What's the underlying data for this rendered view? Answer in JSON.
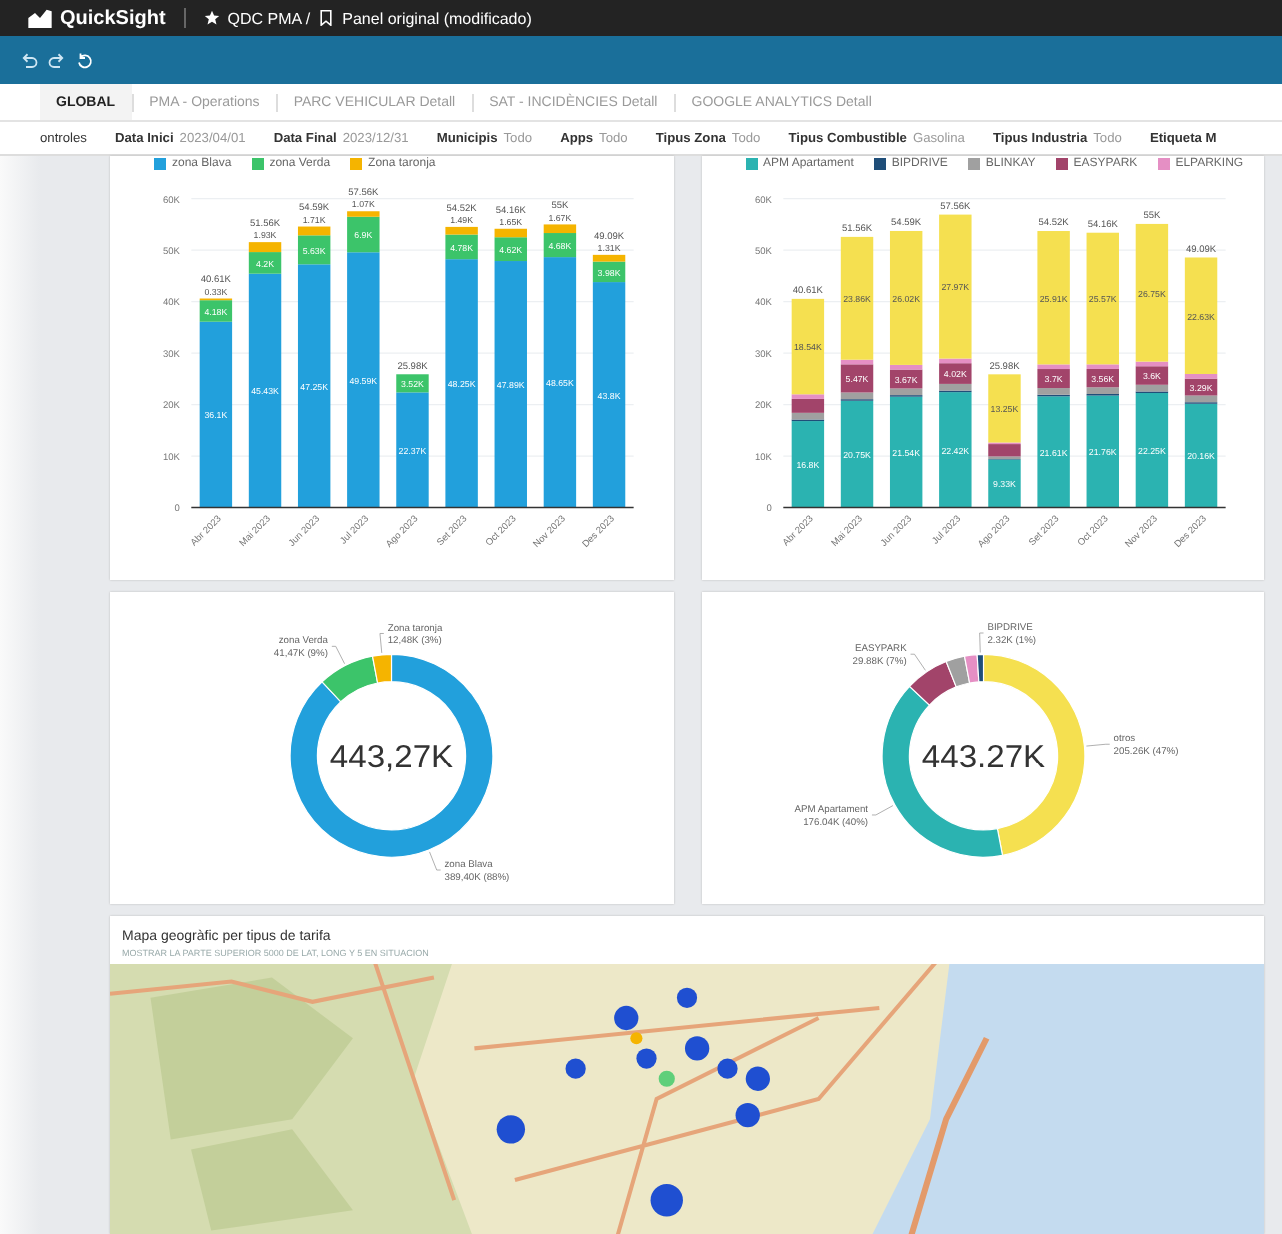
{
  "app": {
    "name": "QuickSight",
    "breadcrumb": "QDC PMA /",
    "title": "Panel original (modificado)"
  },
  "tabs": [
    {
      "label": "GLOBAL",
      "selected": true
    },
    {
      "label": "PMA - Operations",
      "selected": false
    },
    {
      "label": "PARC VEHICULAR Detall",
      "selected": false
    },
    {
      "label": "SAT - INCIDÈNCIES Detall",
      "selected": false
    },
    {
      "label": "GOOGLE ANALYTICS Detall",
      "selected": false
    }
  ],
  "controls_label": "ontroles",
  "filters": [
    {
      "label": "Data Inici",
      "value": "2023/04/01"
    },
    {
      "label": "Data Final",
      "value": "2023/12/31"
    },
    {
      "label": "Municipis",
      "value": "Todo"
    },
    {
      "label": "Apps",
      "value": "Todo"
    },
    {
      "label": "Tipus Zona",
      "value": "Todo"
    },
    {
      "label": "Tipus Combustible",
      "value": "Gasolina"
    },
    {
      "label": "Tipus Industria",
      "value": "Todo"
    },
    {
      "label": "Etiqueta M"
    }
  ],
  "bar_charts": [
    {
      "chart_data": {
        "type": "bar",
        "stacked": true,
        "grid": true,
        "categories": [
          "Abr 2023",
          "Mai 2023",
          "Jun 2023",
          "Jul 2023",
          "Ago 2023",
          "Set 2023",
          "Oct 2023",
          "Nov 2023",
          "Des 2023"
        ],
        "ylim": [
          0,
          60
        ],
        "yticks": [
          {
            "value": 0,
            "label": "0"
          },
          {
            "value": 10,
            "label": "10K"
          },
          {
            "value": 20,
            "label": "20K"
          },
          {
            "value": 30,
            "label": "30K"
          },
          {
            "value": 40,
            "label": "40K"
          },
          {
            "value": 50,
            "label": "50K"
          },
          {
            "value": 60,
            "label": "60K"
          }
        ],
        "annotations": [
          "40.61K",
          "51.56K",
          "54.59K",
          "57.56K",
          "25.98K",
          "54.52K",
          "54.16K",
          "55K",
          "49.09K"
        ],
        "series": [
          {
            "name": "zona Blava",
            "color": "#22a0dc",
            "values": [
              36.1,
              45.43,
              47.25,
              49.59,
              22.37,
              48.25,
              47.89,
              48.65,
              43.8
            ],
            "value_labels": [
              "36.1K",
              "45.43K",
              "47.25K",
              "49.59K",
              "22.37K",
              "48.25K",
              "47.89K",
              "48.65K",
              "43.8K"
            ]
          },
          {
            "name": "zona Verda",
            "color": "#3cc46a",
            "values": [
              4.18,
              4.2,
              5.63,
              6.9,
              3.52,
              4.78,
              4.62,
              4.68,
              3.98
            ],
            "value_labels": [
              "4.18K",
              "4.2K",
              "5.63K",
              "6.9K",
              "3.52K",
              "4.78K",
              "4.62K",
              "4.68K",
              "3.98K"
            ]
          },
          {
            "name": "Zona taronja",
            "color": "#f5b400",
            "values": [
              0.33,
              1.93,
              1.71,
              1.07,
              null,
              1.49,
              1.65,
              1.67,
              1.31
            ],
            "value_labels": [
              "0.33K",
              "1.93K",
              "1.71K",
              "1.07K",
              null,
              "1.49K",
              "1.65K",
              "1.67K",
              "1.31K"
            ]
          }
        ]
      }
    },
    {
      "chart_data": {
        "type": "bar",
        "stacked": true,
        "grid": true,
        "categories": [
          "Abr 2023",
          "Mai 2023",
          "Jun 2023",
          "Jul 2023",
          "Ago 2023",
          "Set 2023",
          "Oct 2023",
          "Nov 2023",
          "Des 2023"
        ],
        "ylim": [
          0,
          60
        ],
        "yticks": [
          {
            "value": 0,
            "label": "0"
          },
          {
            "value": 10,
            "label": "10K"
          },
          {
            "value": 20,
            "label": "20K"
          },
          {
            "value": 30,
            "label": "30K"
          },
          {
            "value": 40,
            "label": "40K"
          },
          {
            "value": 50,
            "label": "50K"
          },
          {
            "value": 60,
            "label": "60K"
          }
        ],
        "annotations": [
          "40.61K",
          "51.56K",
          "54.59K",
          "57.56K",
          "25.98K",
          "54.52K",
          "54.16K",
          "55K",
          "49.09K"
        ],
        "series": [
          {
            "name": "APM Apartament",
            "color": "#2bb3b1",
            "values": [
              16.8,
              20.75,
              21.54,
              22.42,
              9.33,
              21.61,
              21.76,
              22.25,
              20.16
            ],
            "value_labels": [
              "16.8K",
              "20.75K",
              "21.54K",
              "22.42K",
              "9.33K",
              "21.61K",
              "21.76K",
              "22.25K",
              "20.16K"
            ]
          },
          {
            "name": "BIPDRIVE",
            "color": "#1f4e79",
            "values": [
              0.3,
              0.3,
              0.3,
              0.3,
              0.1,
              0.3,
              0.3,
              0.3,
              0.3
            ]
          },
          {
            "name": "BLINKAY",
            "color": "#a0a0a0",
            "values": [
              1.3,
              1.3,
              1.3,
              1.3,
              0.5,
              1.3,
              1.3,
              1.3,
              1.3
            ]
          },
          {
            "name": "EASYPARK",
            "color": "#a2446a",
            "values": [
              2.7,
              5.47,
              3.67,
              4.02,
              2.4,
              3.7,
              3.56,
              3.6,
              3.29
            ],
            "value_labels": [
              null,
              "5.47K",
              "3.67K",
              "4.02K",
              null,
              "3.7K",
              "3.56K",
              "3.6K",
              "3.29K"
            ]
          },
          {
            "name": "ELPARKING",
            "color": "#e58fc4",
            "values": [
              0.9,
              0.9,
              0.9,
              0.9,
              0.3,
              0.9,
              0.9,
              0.9,
              0.9
            ]
          },
          {
            "name": null,
            "color": "#f5e050",
            "values": [
              18.54,
              23.86,
              26.02,
              27.97,
              13.25,
              25.91,
              25.57,
              26.75,
              22.63
            ],
            "value_labels": [
              "18.54K",
              "23.86K",
              "26.02K",
              "27.97K",
              "13.25K",
              "25.91K",
              "25.57K",
              "26.75K",
              "22.63K"
            ]
          }
        ]
      }
    }
  ],
  "donuts": [
    {
      "chart_data": {
        "type": "donut",
        "annotations": [
          "443,27K"
        ],
        "categories": [
          "zona Blava",
          "zona Verda",
          "Zona taronja"
        ],
        "colors": [
          "#22a0dc",
          "#3cc46a",
          "#f5b400"
        ],
        "values": [
          88,
          9,
          3
        ],
        "value_labels": [
          "389,40K (88%)",
          "41,47K (9%)",
          "12,48K (3%)"
        ]
      }
    },
    {
      "chart_data": {
        "type": "donut",
        "annotations": [
          "443.27K"
        ],
        "categories": [
          "otros",
          "APM Apartament",
          "EASYPARK",
          null,
          null,
          "BIPDRIVE"
        ],
        "colors": [
          "#f5e050",
          "#2bb3b1",
          "#a2446a",
          "#a0a0a0",
          "#e58fc4",
          "#1f4e79"
        ],
        "values": [
          47,
          40,
          7,
          3,
          2,
          1
        ],
        "value_labels": [
          "205.26K (47%)",
          "176.04K (40%)",
          "29.88K (7%)",
          null,
          null,
          "2.32K (1%)"
        ]
      }
    }
  ],
  "map": {
    "title": "Mapa geogràfic per tipus de tarifa",
    "subtitle": "MOSTRAR LA PARTE SUPERIOR 5000 DE LAT, LONG Y 5 EN SITUACION",
    "kind": "picture"
  }
}
